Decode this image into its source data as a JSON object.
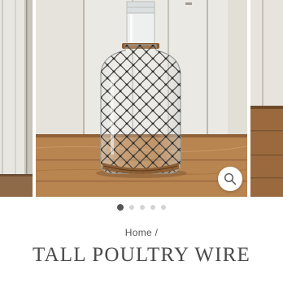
{
  "gallery": {
    "slide_count": 5,
    "active_slide": 1,
    "zoom_icon": "magnifier-icon"
  },
  "breadcrumb": {
    "home_label": "Home",
    "separator": "/"
  },
  "product": {
    "title": "TALL POULTRY WIRE"
  },
  "colors": {
    "wood_wall": "#e9e6df",
    "table_wood": "#b8844f",
    "wire": "#3a3a3a",
    "rust_band": "#8a5a30",
    "active_dot": "#555555",
    "inactive_dot": "#d4d4d4"
  }
}
